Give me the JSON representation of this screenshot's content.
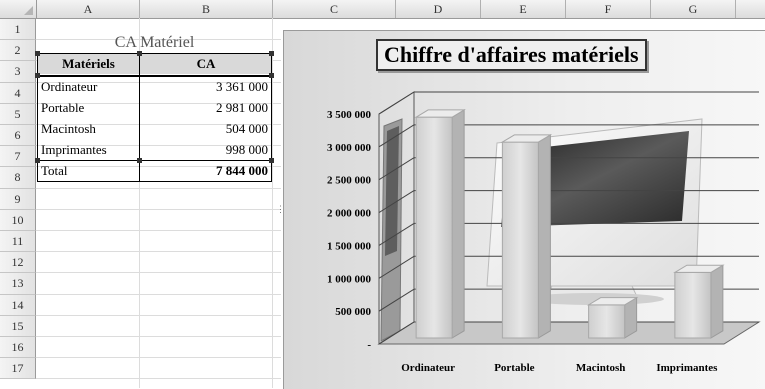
{
  "columns": [
    "A",
    "B",
    "C",
    "D",
    "E",
    "F",
    "G"
  ],
  "rows": [
    "1",
    "2",
    "3",
    "4",
    "5",
    "6",
    "7",
    "8",
    "9",
    "10",
    "11",
    "12",
    "13",
    "14",
    "15",
    "16",
    "17"
  ],
  "table": {
    "title": "CA Matériel",
    "headers": [
      "Matériels",
      "CA"
    ],
    "items": [
      {
        "name": "Ordinateur",
        "value": "3 361 000"
      },
      {
        "name": "Portable",
        "value": "2 981 000"
      },
      {
        "name": "Macintosh",
        "value": "504 000"
      },
      {
        "name": "Imprimantes",
        "value": "998 000"
      }
    ],
    "total_label": "Total",
    "total_value": "7 844 000"
  },
  "chart_title": "Chiffre d'affaires matériels",
  "chart_data": {
    "type": "bar",
    "title": "Chiffre d'affaires matériels",
    "categories": [
      "Ordinateur",
      "Portable",
      "Macintosh",
      "Imprimantes"
    ],
    "values": [
      3361000,
      2981000,
      504000,
      998000
    ],
    "ylim": [
      0,
      3500000
    ],
    "yticks": [
      0,
      500000,
      1000000,
      1500000,
      2000000,
      2500000,
      3000000,
      3500000
    ],
    "ytick_labels": [
      "-",
      "500 000",
      "1 000 000",
      "1 500 000",
      "2 000 000",
      "2 500 000",
      "3 000 000",
      "3 500 000"
    ],
    "grid": true,
    "legend": "none",
    "style": "3d-column"
  }
}
